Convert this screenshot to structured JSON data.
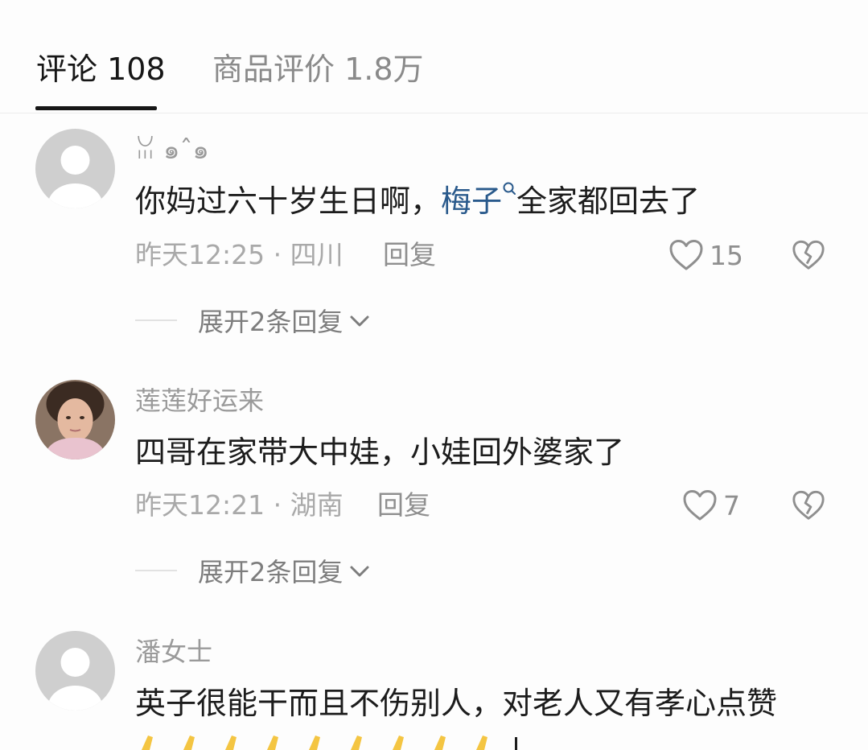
{
  "tabs": {
    "comments_label": "评论 108",
    "reviews_label": "商品评价 1.8万"
  },
  "comments": [
    {
      "username": "ꈍ ๑ˆ๑",
      "text_before": "你妈过六十岁生日啊，",
      "mention": "梅子",
      "text_after": "全家都回去了",
      "time_location": "昨天12:25 · 四川",
      "reply_label": "回复",
      "likes": "15",
      "expand_label": "展开2条回复",
      "avatar": "default-avatar"
    },
    {
      "username": "莲莲好运来",
      "text": "四哥在家带大中娃，小娃回外婆家了",
      "time_location": "昨天12:21 · 湖南",
      "reply_label": "回复",
      "likes": "7",
      "expand_label": "展开2条回复",
      "avatar": "photo-avatar"
    },
    {
      "username": "潘女士",
      "text": "英子很能干而且不伤别人，对老人又有孝心点赞",
      "avatar": "default-avatar"
    }
  ],
  "icons": {
    "like": "heart-outline-icon",
    "dislike": "broken-heart-icon",
    "expand": "chevron-down-icon",
    "mention": "search-icon"
  },
  "colors": {
    "mention": "#2a5a8c",
    "meta_text": "#a9a9a9",
    "active_tab": "#161616",
    "inactive_tab": "#8a8a8a"
  }
}
